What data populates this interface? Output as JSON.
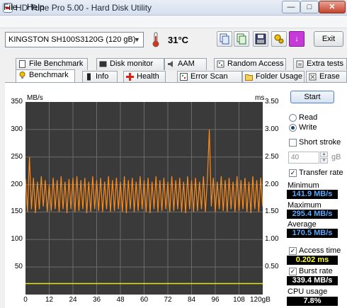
{
  "window": {
    "title": "HD Tune Pro 5.00 - Hard Disk Utility",
    "min": "—",
    "max": "□",
    "close": "✕"
  },
  "menu": {
    "file": "File",
    "help": "Help"
  },
  "toolbar": {
    "drive": "KINGSTON SH100S3120G     (120 gB)",
    "temperature": "31°C",
    "exit_label": "Exit",
    "arrow_label": "↓"
  },
  "tabs_top": [
    "File Benchmark",
    "Disk monitor",
    "AAM",
    "Random Access",
    "Extra tests"
  ],
  "tabs_bottom": [
    "Benchmark",
    "Info",
    "Health",
    "Error Scan",
    "Folder Usage",
    "Erase"
  ],
  "chart": {
    "left_unit": "MB/s",
    "right_unit": "ms",
    "left_ticks": [
      "350",
      "300",
      "250",
      "200",
      "150",
      "100",
      "50"
    ],
    "right_ticks": [
      "3.50",
      "3.00",
      "2.50",
      "2.00",
      "1.50",
      "1.00",
      "0.50"
    ],
    "x_ticks": [
      "0",
      "12",
      "24",
      "36",
      "48",
      "60",
      "72",
      "84",
      "96",
      "108",
      "120gB"
    ]
  },
  "chart_data": {
    "type": "line",
    "x_unit": "gB",
    "xlim": [
      0,
      120
    ],
    "ylim_left": [
      0,
      350
    ],
    "ylim_right": [
      0,
      3.5
    ],
    "series": [
      {
        "name": "Transfer rate",
        "color": "#ff8c1a",
        "axis": "left",
        "x": [
          0,
          1,
          2,
          3,
          4,
          5,
          6,
          7,
          8,
          9,
          10,
          11,
          12,
          13,
          14,
          15,
          16,
          17,
          18,
          19,
          20,
          21,
          22,
          23,
          24,
          25,
          26,
          27,
          28,
          29,
          30,
          31,
          32,
          33,
          34,
          35,
          36,
          37,
          38,
          39,
          40,
          41,
          42,
          43,
          44,
          45,
          46,
          47,
          48,
          49,
          50,
          51,
          52,
          53,
          54,
          55,
          56,
          57,
          58,
          59,
          60,
          61,
          62,
          63,
          64,
          65,
          66,
          67,
          68,
          69,
          70,
          71,
          72,
          73,
          74,
          75,
          76,
          77,
          78,
          79,
          80,
          81,
          82,
          83,
          84,
          85,
          86,
          87,
          88,
          89,
          90,
          91,
          92,
          93,
          94,
          95,
          96,
          97,
          98,
          99,
          100,
          101,
          102,
          103,
          104,
          105,
          106,
          107,
          108,
          109,
          110,
          111,
          112,
          113,
          114,
          115,
          116,
          117,
          118,
          119,
          120
        ],
        "y": [
          210,
          150,
          250,
          155,
          212,
          148,
          205,
          155,
          215,
          160,
          208,
          150,
          200,
          152,
          212,
          155,
          208,
          150,
          215,
          155,
          205,
          148,
          210,
          155,
          212,
          150,
          215,
          152,
          208,
          155,
          212,
          148,
          205,
          150,
          215,
          155,
          208,
          152,
          212,
          150,
          205,
          155,
          215,
          150,
          208,
          152,
          212,
          155,
          205,
          150,
          215,
          148,
          208,
          155,
          212,
          150,
          205,
          152,
          215,
          155,
          208,
          150,
          212,
          148,
          205,
          155,
          215,
          150,
          208,
          152,
          212,
          155,
          205,
          150,
          215,
          152,
          208,
          155,
          212,
          150,
          205,
          148,
          215,
          155,
          208,
          150,
          212,
          152,
          205,
          155,
          215,
          150,
          208,
          300,
          160,
          212,
          150,
          205,
          155,
          215,
          152,
          208,
          150,
          212,
          155,
          205,
          150,
          215,
          152,
          208,
          155,
          212,
          150,
          205,
          148,
          215,
          155,
          208,
          150,
          212,
          160
        ]
      },
      {
        "name": "Access time",
        "color": "#e5e51a",
        "axis": "right",
        "x": [
          0,
          12,
          24,
          36,
          48,
          60,
          72,
          84,
          96,
          108,
          120
        ],
        "y": [
          0.2,
          0.2,
          0.2,
          0.2,
          0.2,
          0.2,
          0.2,
          0.2,
          0.2,
          0.2,
          0.2
        ]
      }
    ]
  },
  "panel": {
    "start_label": "Start",
    "read_label": "Read",
    "write_label": "Write",
    "short_stroke_label": "Short stroke",
    "short_stroke_value": "40",
    "short_stroke_unit": "gB",
    "transfer_rate_label": "Transfer rate",
    "minimum_label": "Minimum",
    "minimum_value": "141.9 MB/s",
    "maximum_label": "Maximum",
    "maximum_value": "295.4 MB/s",
    "average_label": "Average",
    "average_value": "170.5 MB/s",
    "access_time_label": "Access time",
    "access_time_value": "0.202 ms",
    "burst_rate_label": "Burst rate",
    "burst_rate_value": "339.4 MB/s",
    "cpu_label": "CPU usage",
    "cpu_value": "7.8%"
  }
}
